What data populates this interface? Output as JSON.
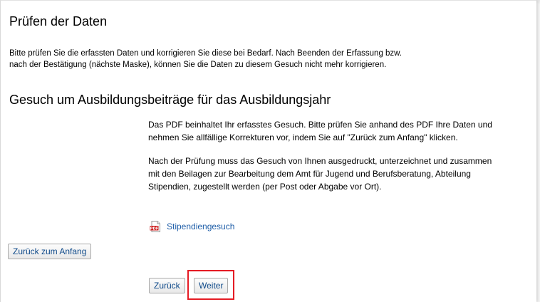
{
  "page": {
    "title": "Prüfen der Daten",
    "intro": "Bitte prüfen Sie die erfassten Daten und korrigieren Sie diese bei Bedarf. Nach Beenden der Erfassung bzw. nach der Bestätigung (nächste Maske), können Sie die Daten zu diesem Gesuch nicht mehr korrigieren."
  },
  "section": {
    "title": "Gesuch um Ausbildungsbeiträge für das Ausbildungsjahr",
    "paragraph1": "Das PDF beinhaltet Ihr erfasstes Gesuch. Bitte prüfen Sie anhand des PDF Ihre Daten und\nnehmen Sie allfällige Korrekturen vor, indem Sie auf \"Zurück zum Anfang\" klicken.",
    "paragraph2": "Nach der Prüfung muss das Gesuch von Ihnen ausgedruckt, unterzeichnet und zusammen\nmit den Beilagen zur Bearbeitung dem Amt für Jugend und Berufsberatung, Abteilung\nStipendien, zugestellt werden (per Post oder Abgabe vor Ort).",
    "pdf_link_label": "Stipendiengesuch",
    "pdf_icon": "pdf-file-icon"
  },
  "buttons": {
    "back_to_start": "Zurück zum Anfang",
    "back": "Zurück",
    "next": "Weiter"
  },
  "colors": {
    "link": "#1f5ea8",
    "highlight": "#e51b24"
  }
}
